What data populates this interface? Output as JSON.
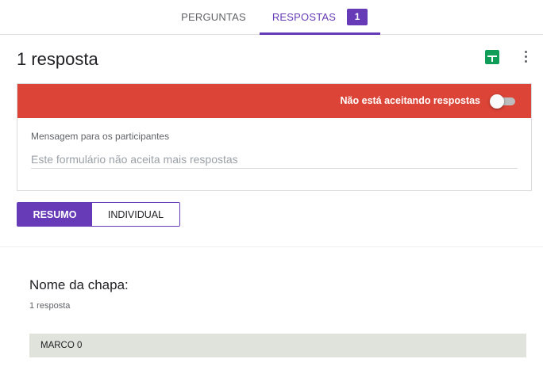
{
  "tabs": {
    "questions_label": "PERGUNTAS",
    "responses_label": "RESPOSTAS",
    "responses_badge": "1"
  },
  "header": {
    "response_count": "1 resposta",
    "icons": [
      "sheets-icon",
      "more-vert-icon"
    ]
  },
  "accepting": {
    "label": "Não está aceitando respostas",
    "enabled": false,
    "bar_color": "#db4437",
    "message_label": "Mensagem para os participantes",
    "message_placeholder": "Este formulário não aceita mais respostas"
  },
  "view_toggle": {
    "summary_label": "RESUMO",
    "individual_label": "INDIVIDUAL",
    "selected": "RESUMO",
    "accent": "#673ab7"
  },
  "question": {
    "title": "Nome da chapa:",
    "count": "1 resposta",
    "answers": [
      "MARCO 0"
    ]
  }
}
